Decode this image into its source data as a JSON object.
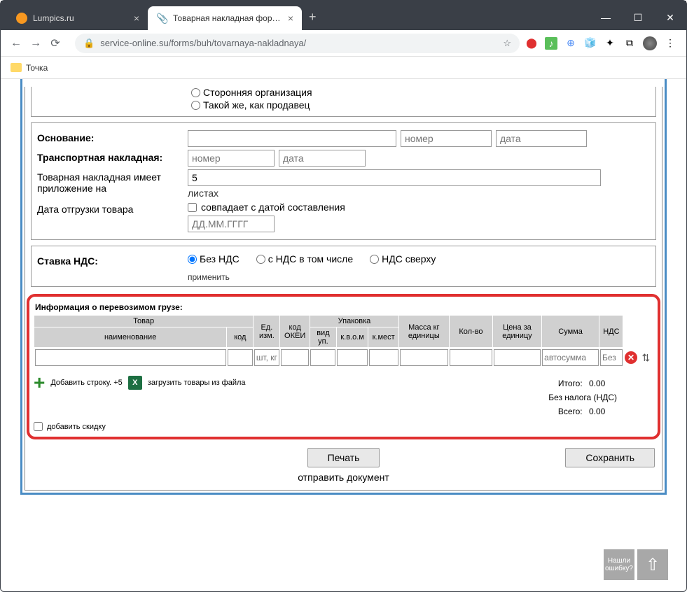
{
  "browser": {
    "tabs": [
      {
        "title": "Lumpics.ru"
      },
      {
        "title": "Товарная накладная форма №"
      }
    ],
    "url": "service-online.su/forms/buh/tovarnaya-nakladnaya/"
  },
  "bookmarks": {
    "item1": "Точка"
  },
  "radios": {
    "other_org": "Сторонняя организация",
    "same_as_seller": "Такой же, как продавец"
  },
  "form": {
    "basis_label": "Основание:",
    "basis_num_ph": "номер",
    "basis_date_ph": "дата",
    "transport_label": "Транспортная накладная:",
    "transport_num_ph": "номер",
    "transport_date_ph": "дата",
    "attachment_label": "Товарная накладная имеет приложение на",
    "attachment_value": "5",
    "attachment_unit": "листах",
    "ship_date_label": "Дата отгрузки товара",
    "ship_date_match": "совпадает с датой составления",
    "ship_date_ph": "ДД.ММ.ГГГГ"
  },
  "vat": {
    "label": "Ставка НДС:",
    "none": "Без НДС",
    "included": "с НДС в том числе",
    "on_top": "НДС сверху",
    "apply": "применить"
  },
  "cargo": {
    "title": "Информация о перевозимом грузе:",
    "headers": {
      "product": "Товар",
      "name": "наименование",
      "code": "код",
      "unit": "Ед. изм.",
      "okei": "код ОКЕИ",
      "package": "Упаковка",
      "pkg_type": "вид уп.",
      "pkg_in": "к.в.о.м",
      "pkg_places": "к.мест",
      "mass": "Масса кг единицы",
      "qty": "Кол-во",
      "price": "Цена за единицу",
      "sum": "Сумма",
      "nds": "НДС"
    },
    "row": {
      "unit_ph": "шт, кг",
      "sum_ph": "автосумма",
      "nds_ph": "Без"
    },
    "add_row": "Добавить строку. +5",
    "load_file": "загрузить товары из файла",
    "add_discount": "добавить скидку",
    "totals": {
      "itogo_label": "Итого:",
      "itogo_value": "0.00",
      "no_tax": "Без налога (НДС)",
      "vsego_label": "Всего:",
      "vsego_value": "0.00"
    }
  },
  "buttons": {
    "print": "Печать",
    "save": "Сохранить",
    "send": "отправить документ",
    "found_error": "Нашли ошибку?"
  }
}
